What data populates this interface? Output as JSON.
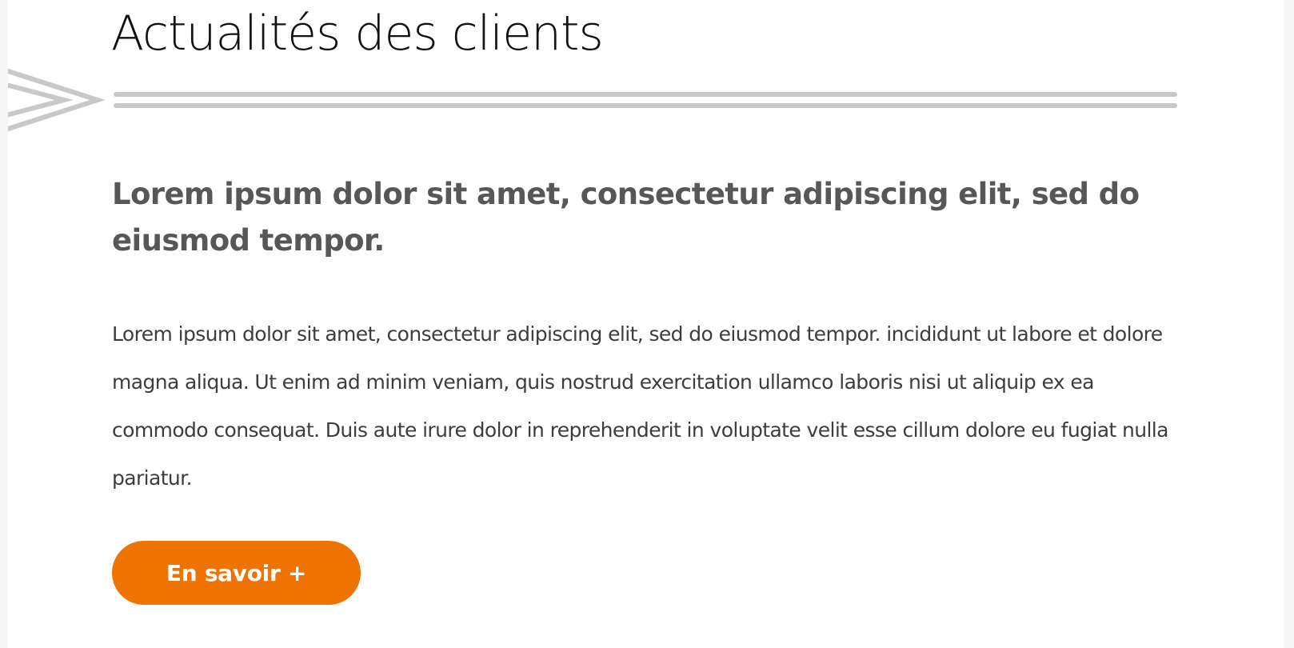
{
  "section": {
    "title": "Actualités des clients"
  },
  "article": {
    "headline": "Lorem ipsum dolor sit amet, consectetur adipiscing elit, sed do eiusmod tempor.",
    "body": "Lorem ipsum dolor sit amet, consectetur adipiscing elit, sed do eiusmod tempor. incididunt ut labore et dolore magna aliqua. Ut enim ad minim veniam, quis nostrud exercitation ullamco laboris nisi ut aliquip ex ea commodo consequat. Duis aute irure dolor in reprehenderit in voluptate velit esse cillum dolore eu fugiat nulla pariatur.",
    "cta_label": "En savoir +"
  },
  "decor": {
    "icon": "chevron-right-lines-icon"
  },
  "colors": {
    "accent": "#ee7300",
    "divider": "#c8c8c8",
    "headline": "#575757",
    "body": "#3d3d3d",
    "title": "#111111"
  }
}
